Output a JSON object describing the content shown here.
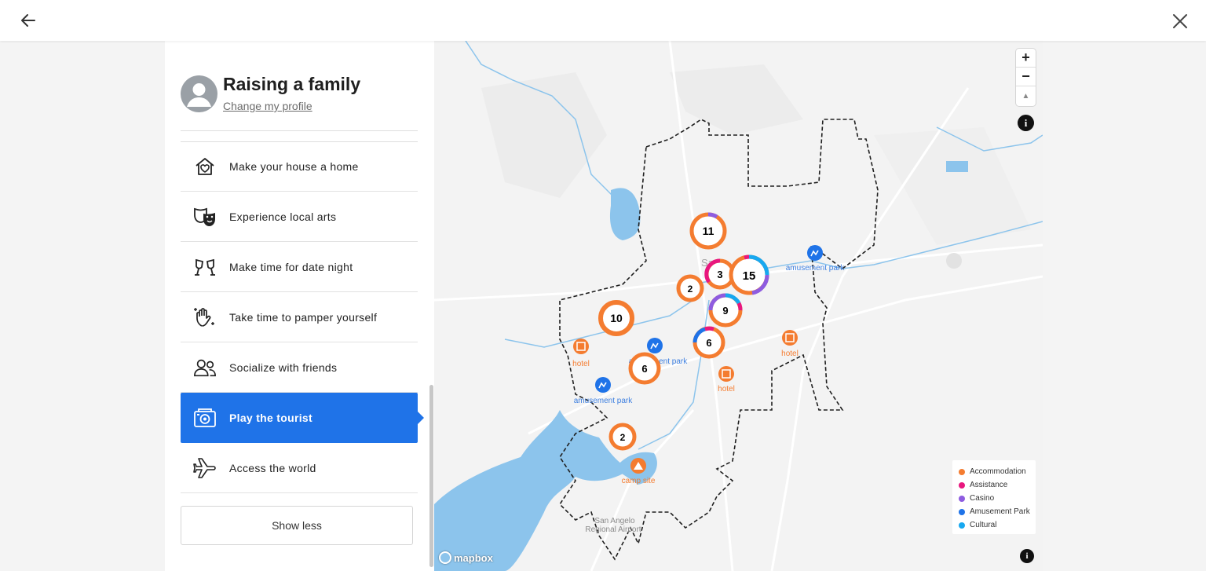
{
  "topbar": {
    "back_icon": "arrow-left-icon",
    "close_icon": "close-x-icon"
  },
  "profile": {
    "name": "Raising a family",
    "change_link": "Change my profile"
  },
  "menu": {
    "items": [
      {
        "label": "Make your house a home",
        "icon": "house-heart-icon"
      },
      {
        "label": "Experience local arts",
        "icon": "theater-masks-icon"
      },
      {
        "label": "Make time for date night",
        "icon": "cheers-glasses-icon"
      },
      {
        "label": "Take time to pamper yourself",
        "icon": "sparkle-hand-icon"
      },
      {
        "label": "Socialize with friends",
        "icon": "people-icon"
      },
      {
        "label": "Play the tourist",
        "icon": "camera-icon",
        "active": true
      },
      {
        "label": "Access the world",
        "icon": "airplane-icon"
      }
    ],
    "show_less": "Show less"
  },
  "map": {
    "clusters": [
      {
        "count": "11"
      },
      {
        "count": "3"
      },
      {
        "count": "15"
      },
      {
        "count": "2"
      },
      {
        "count": "9"
      },
      {
        "count": "10"
      },
      {
        "count": "6"
      },
      {
        "count": "6"
      },
      {
        "count": "2"
      }
    ],
    "poi_labels": {
      "amusement_park_1": "amusement park",
      "amusement_park_2": "amusement park",
      "amusement_park_3": "amusement park",
      "hotel_1": "hotel",
      "hotel_2": "hotel",
      "hotel_3": "hotel",
      "camp_site": "camp site",
      "city": "San",
      "airport_1": "San Angelo",
      "airport_2": "Regional Airport"
    },
    "controls": {
      "zoom_in": "+",
      "zoom_out": "−",
      "compass": "▲",
      "info": "i"
    },
    "attribution": "mapbox"
  },
  "legend": {
    "items": [
      {
        "label": "Accommodation",
        "color": "#f47c30"
      },
      {
        "label": "Assistance",
        "color": "#e8177e"
      },
      {
        "label": "Casino",
        "color": "#8e5ce0"
      },
      {
        "label": "Amusement Park",
        "color": "#1f73e8"
      },
      {
        "label": "Cultural",
        "color": "#17a8f0"
      }
    ]
  }
}
